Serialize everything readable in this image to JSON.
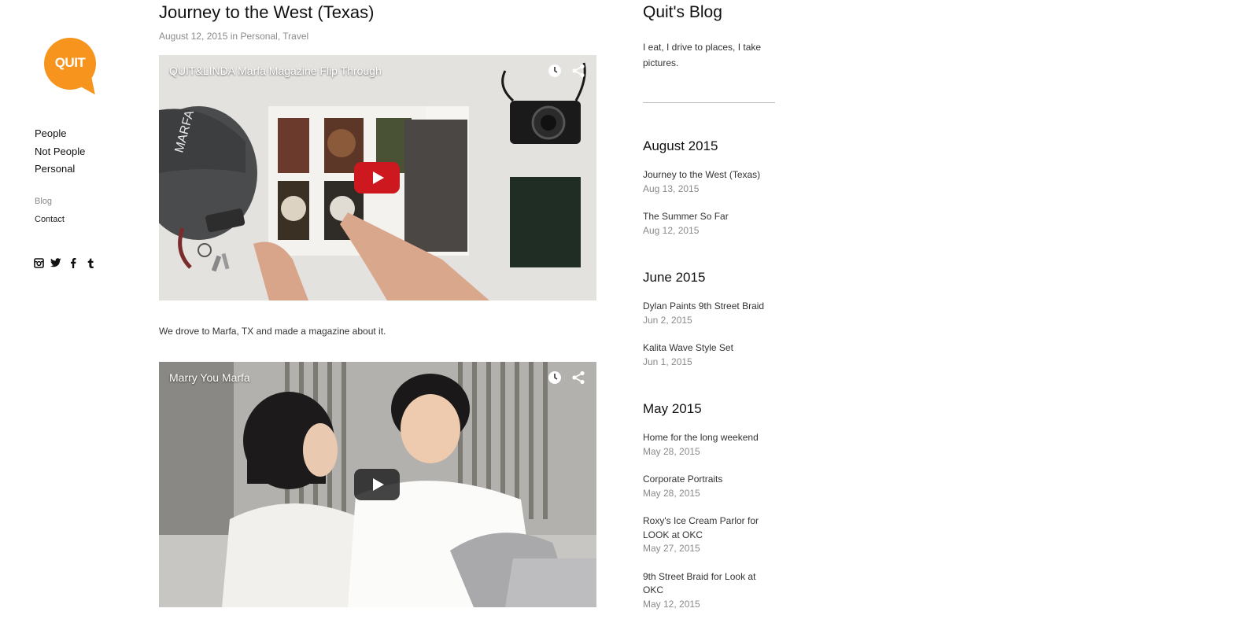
{
  "logo": {
    "text": "QUIT",
    "color": "#f7941d"
  },
  "nav": {
    "main": [
      "People",
      "Not People",
      "Personal"
    ],
    "sub": [
      {
        "label": "Blog",
        "active": true
      },
      {
        "label": "Contact",
        "active": false
      }
    ],
    "social": [
      "instagram-icon",
      "twitter-icon",
      "facebook-icon",
      "tumblr-icon"
    ]
  },
  "post": {
    "title": "Journey to the West (Texas)",
    "date": "August 12, 2015",
    "in_text": "in",
    "categories": [
      "Personal",
      "Travel"
    ],
    "videos": [
      {
        "title": "QUIT&LINDA Marfa Magazine Flip Through",
        "play_color": "#cc181e"
      },
      {
        "title": "Marry You Marfa",
        "play_color": "#2b2b2b"
      }
    ],
    "body": "We drove to Marfa, TX and made a magazine about it."
  },
  "sidebar": {
    "title": "Quit's Blog",
    "description": "I eat, I drive to places, I take pictures.",
    "archive": [
      {
        "month": "August 2015",
        "posts": [
          {
            "title": "Journey to the West (Texas)",
            "date": "Aug 13, 2015"
          },
          {
            "title": "The Summer So Far",
            "date": "Aug 12, 2015"
          }
        ]
      },
      {
        "month": "June 2015",
        "posts": [
          {
            "title": "Dylan Paints 9th Street Braid",
            "date": "Jun 2, 2015"
          },
          {
            "title": "Kalita Wave Style Set",
            "date": "Jun 1, 2015"
          }
        ]
      },
      {
        "month": "May 2015",
        "posts": [
          {
            "title": "Home for the long weekend",
            "date": "May 28, 2015"
          },
          {
            "title": "Corporate Portraits",
            "date": "May 28, 2015"
          },
          {
            "title": "Roxy's Ice Cream Parlor for LOOK at OKC",
            "date": "May 27, 2015"
          },
          {
            "title": "9th Street Braid for Look at OKC",
            "date": "May 12, 2015"
          }
        ]
      }
    ]
  }
}
